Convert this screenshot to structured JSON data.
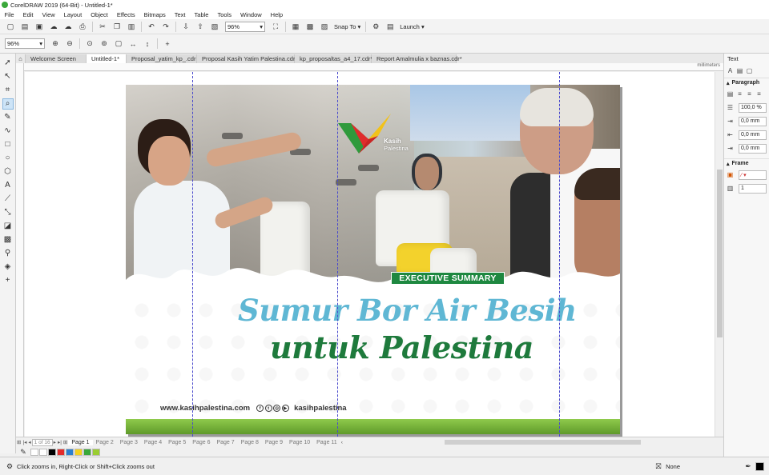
{
  "window": {
    "title": "CorelDRAW 2019 (64-Bit) - Untitled-1*"
  },
  "menu": [
    "File",
    "Edit",
    "View",
    "Layout",
    "Object",
    "Effects",
    "Bitmaps",
    "Text",
    "Table",
    "Tools",
    "Window",
    "Help"
  ],
  "toolbar": {
    "zoom_value": "96%",
    "snap_to_label": "Snap To",
    "launch_label": "Launch"
  },
  "property_bar": {
    "zoom_value": "96%"
  },
  "tabs": [
    {
      "label": "Welcome Screen",
      "active": false
    },
    {
      "label": "Untitled-1*",
      "active": true
    },
    {
      "label": "Proposal_yatim_kp_.cdr",
      "active": false
    },
    {
      "label": "Proposal Kasih Yatim Palestina.cdr*",
      "active": false
    },
    {
      "label": "kp_proposaltas_a4_17.cdr*",
      "active": false
    },
    {
      "label": "Report Amalmulia x baznas.cdr*",
      "active": false
    }
  ],
  "ruler": {
    "units": "millimeters"
  },
  "design": {
    "logo_name": "Kasih",
    "logo_sub": "Palestina",
    "badge": "EXECUTIVE SUMMARY",
    "title_line1": "Sumur Bor Air Besih",
    "title_line2": "untuk Palestina",
    "website": "www.kasihpalestina.com",
    "social_handle": "kasihpalestina",
    "colors": {
      "light_blue": "#5fb7d4",
      "dark_green": "#1e7a3c",
      "badge_green": "#1e8840"
    }
  },
  "pages": {
    "current": "1",
    "total": "of 16",
    "items": [
      "Page 1",
      "Page 2",
      "Page 3",
      "Page 4",
      "Page 5",
      "Page 6",
      "Page 7",
      "Page 8",
      "Page 9",
      "Page 10",
      "Page 11"
    ]
  },
  "palette": [
    "#ffffff",
    "#000000",
    "#e32b2b",
    "#2a7fd1",
    "#f5d21e",
    "#3aa83a",
    "#9acd32"
  ],
  "status": {
    "hint": "Click zooms in, Right-Click or Shift+Click zooms out",
    "fill": "None"
  },
  "panel": {
    "title": "Text",
    "paragraph_section": "Paragraph",
    "line_spacing": "100,0 %",
    "indent1": "0,0 mm",
    "indent2": "0,0 mm",
    "indent3": "0,0 mm",
    "frame_section": "Frame",
    "columns": "1"
  }
}
